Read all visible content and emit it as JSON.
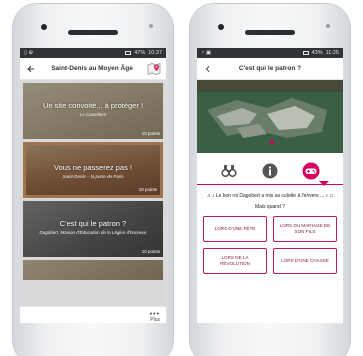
{
  "left_phone": {
    "status": {
      "signal_text": "▯ ⊕",
      "battery_text": "47%",
      "time": "10:37"
    },
    "appbar": {
      "title": "Saint-Denis au Moyen Âge"
    },
    "cards": [
      {
        "title": "Un site convoité... à protéger !",
        "subtitle": "Le Castellum",
        "points": "10 points"
      },
      {
        "title": "Vous ne passerez pas !",
        "subtitle": "Saint-Denis – la porte de Paris",
        "points": "10 points"
      },
      {
        "title": "C'est qui le patron ?",
        "subtitle": "Dagobert, Maison d'Éducation de la Légion d'honneur",
        "points": "10 points"
      },
      {
        "title": "",
        "subtitle": "",
        "points": ""
      }
    ],
    "more": {
      "dots": "•••",
      "label": "Plus"
    }
  },
  "right_phone": {
    "status": {
      "signal_text": "◔ ▣",
      "battery_text": "43%",
      "time": "11:25"
    },
    "appbar": {
      "title": "C'est qui le patron ?"
    },
    "song": "♫ ♪ Le bon roi Dagobert a mis sa culotte à l'envers ... ♪ ♫",
    "question": "Mais quand ?",
    "answers": [
      "LORS D'UNE FÊTE",
      "LORS DU MARIAGE DE SON FILS",
      "LORS DE LA RÉVOLUTION",
      "LORS D'UNE CHASSE"
    ],
    "colors": {
      "accent": "#d6005f",
      "answer_text": "#8b1a3a"
    }
  }
}
